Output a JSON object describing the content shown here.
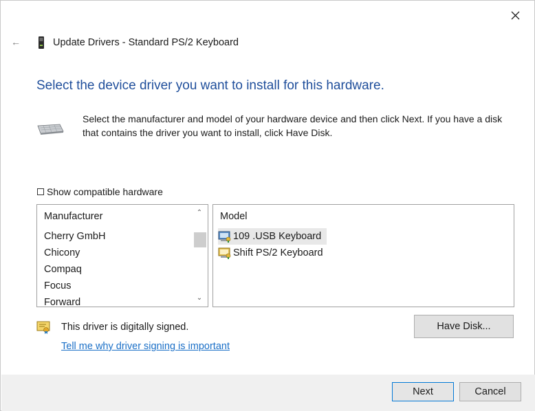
{
  "window": {
    "title": "Update Drivers - Standard PS/2 Keyboard",
    "close_icon": "close-icon",
    "back_icon": "back-arrow-icon",
    "back_glyph": "←"
  },
  "heading": "Select the device driver you want to install for this hardware.",
  "instructions": "Select the manufacturer and model of your hardware device and then click Next. If you have a disk that contains the driver you want to install, click Have Disk.",
  "show_compatible": {
    "label": "Show compatible hardware",
    "checked": false
  },
  "manufacturer_list": {
    "header": "Manufacturer",
    "items": [
      "Cherry GmbH",
      "Chicony",
      "Compaq",
      "Focus",
      "Forward"
    ]
  },
  "model_list": {
    "header": "Model",
    "items": [
      "109 .USB Keyboard",
      "Shift PS/2 Keyboard"
    ],
    "selected_index": 0
  },
  "signing": {
    "status": "This driver is digitally signed.",
    "link": "Tell me why driver signing is important"
  },
  "buttons": {
    "have_disk": "Have Disk...",
    "next": "Next",
    "cancel": "Cancel"
  },
  "colors": {
    "heading": "#1f4e9b",
    "link": "#1a6fc7",
    "default_button_border": "#0078d7",
    "footer_bg": "#f0f0f0"
  }
}
